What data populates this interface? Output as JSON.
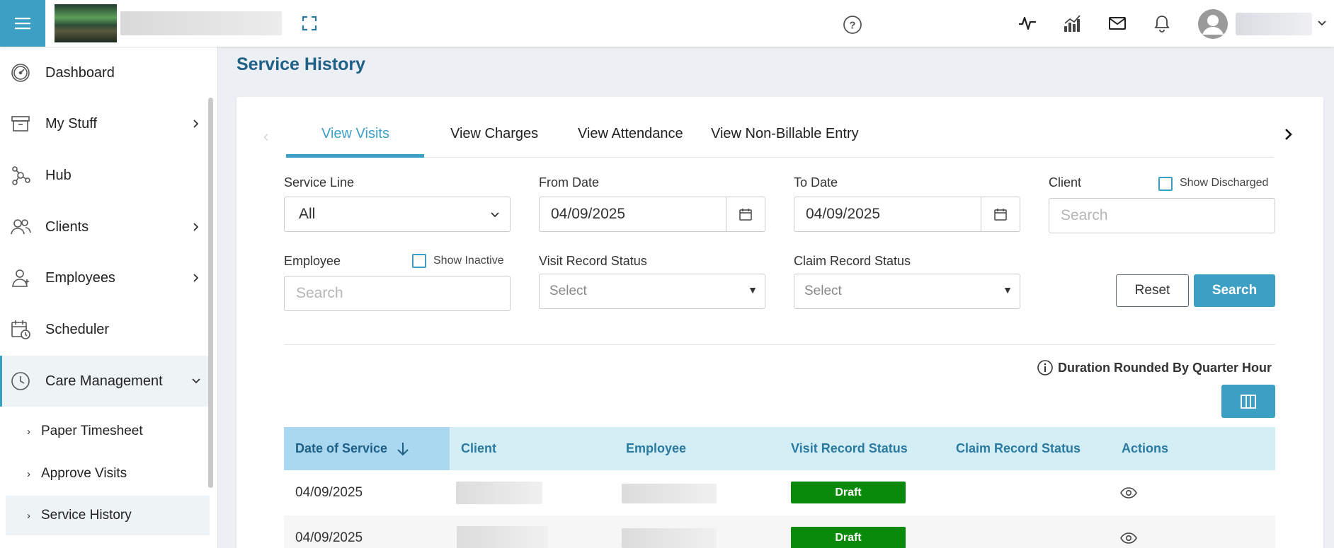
{
  "header": {
    "icons": [
      "menu-icon",
      "fullscreen-icon",
      "help-icon",
      "activity-icon",
      "analytics-icon",
      "mail-icon",
      "bell-icon",
      "user-avatar-icon",
      "chevron-down-icon"
    ]
  },
  "sidebar": {
    "items": [
      {
        "label": "Dashboard",
        "icon": "speedometer-icon"
      },
      {
        "label": "My Stuff",
        "icon": "archive-box-icon"
      },
      {
        "label": "Hub",
        "icon": "hub-network-icon"
      },
      {
        "label": "Clients",
        "icon": "users-icon"
      },
      {
        "label": "Employees",
        "icon": "employee-icon"
      },
      {
        "label": "Scheduler",
        "icon": "calendar-clock-icon"
      },
      {
        "label": "Care Management",
        "icon": "clock-icon"
      }
    ],
    "sub_items": [
      {
        "label": "Paper Timesheet"
      },
      {
        "label": "Approve Visits"
      },
      {
        "label": "Service History"
      }
    ]
  },
  "page": {
    "title": "Service History"
  },
  "tabs": [
    {
      "label": "View Visits",
      "active": true
    },
    {
      "label": "View Charges",
      "active": false
    },
    {
      "label": "View Attendance",
      "active": false
    },
    {
      "label": "View Non-Billable Entry",
      "active": false
    }
  ],
  "filters": {
    "service_line": {
      "label": "Service Line",
      "value": "All"
    },
    "from_date": {
      "label": "From Date",
      "value": "04/09/2025"
    },
    "to_date": {
      "label": "To Date",
      "value": "04/09/2025"
    },
    "client": {
      "label": "Client",
      "placeholder": "Search",
      "checkbox_label": "Show Discharged"
    },
    "employee": {
      "label": "Employee",
      "placeholder": "Search",
      "checkbox_label": "Show Inactive"
    },
    "visit_record_status": {
      "label": "Visit Record Status",
      "value": "Select"
    },
    "claim_record_status": {
      "label": "Claim Record Status",
      "value": "Select"
    },
    "reset_label": "Reset",
    "search_label": "Search"
  },
  "duration_note": "Duration Rounded By Quarter Hour",
  "table": {
    "columns": [
      "Date of Service",
      "Client",
      "Employee",
      "Visit Record Status",
      "Claim Record Status",
      "Actions"
    ],
    "rows": [
      {
        "date": "04/09/2025",
        "visit_status": "Draft"
      },
      {
        "date": "04/09/2025",
        "visit_status": "Draft"
      }
    ]
  },
  "colors": {
    "accent": "#3c9fc4",
    "title": "#1e5f86",
    "draft_badge": "#0a8a0a",
    "table_header": "#d4eef6"
  }
}
